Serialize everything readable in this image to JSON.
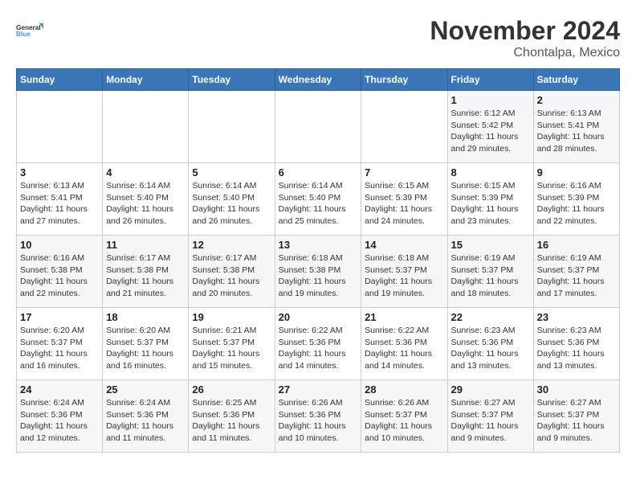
{
  "logo": {
    "line1": "General",
    "line2": "Blue"
  },
  "title": "November 2024",
  "location": "Chontalpa, Mexico",
  "days_of_week": [
    "Sunday",
    "Monday",
    "Tuesday",
    "Wednesday",
    "Thursday",
    "Friday",
    "Saturday"
  ],
  "weeks": [
    [
      {
        "day": "",
        "info": ""
      },
      {
        "day": "",
        "info": ""
      },
      {
        "day": "",
        "info": ""
      },
      {
        "day": "",
        "info": ""
      },
      {
        "day": "",
        "info": ""
      },
      {
        "day": "1",
        "info": "Sunrise: 6:12 AM\nSunset: 5:42 PM\nDaylight: 11 hours and 29 minutes."
      },
      {
        "day": "2",
        "info": "Sunrise: 6:13 AM\nSunset: 5:41 PM\nDaylight: 11 hours and 28 minutes."
      }
    ],
    [
      {
        "day": "3",
        "info": "Sunrise: 6:13 AM\nSunset: 5:41 PM\nDaylight: 11 hours and 27 minutes."
      },
      {
        "day": "4",
        "info": "Sunrise: 6:14 AM\nSunset: 5:40 PM\nDaylight: 11 hours and 26 minutes."
      },
      {
        "day": "5",
        "info": "Sunrise: 6:14 AM\nSunset: 5:40 PM\nDaylight: 11 hours and 26 minutes."
      },
      {
        "day": "6",
        "info": "Sunrise: 6:14 AM\nSunset: 5:40 PM\nDaylight: 11 hours and 25 minutes."
      },
      {
        "day": "7",
        "info": "Sunrise: 6:15 AM\nSunset: 5:39 PM\nDaylight: 11 hours and 24 minutes."
      },
      {
        "day": "8",
        "info": "Sunrise: 6:15 AM\nSunset: 5:39 PM\nDaylight: 11 hours and 23 minutes."
      },
      {
        "day": "9",
        "info": "Sunrise: 6:16 AM\nSunset: 5:39 PM\nDaylight: 11 hours and 22 minutes."
      }
    ],
    [
      {
        "day": "10",
        "info": "Sunrise: 6:16 AM\nSunset: 5:38 PM\nDaylight: 11 hours and 22 minutes."
      },
      {
        "day": "11",
        "info": "Sunrise: 6:17 AM\nSunset: 5:38 PM\nDaylight: 11 hours and 21 minutes."
      },
      {
        "day": "12",
        "info": "Sunrise: 6:17 AM\nSunset: 5:38 PM\nDaylight: 11 hours and 20 minutes."
      },
      {
        "day": "13",
        "info": "Sunrise: 6:18 AM\nSunset: 5:38 PM\nDaylight: 11 hours and 19 minutes."
      },
      {
        "day": "14",
        "info": "Sunrise: 6:18 AM\nSunset: 5:37 PM\nDaylight: 11 hours and 19 minutes."
      },
      {
        "day": "15",
        "info": "Sunrise: 6:19 AM\nSunset: 5:37 PM\nDaylight: 11 hours and 18 minutes."
      },
      {
        "day": "16",
        "info": "Sunrise: 6:19 AM\nSunset: 5:37 PM\nDaylight: 11 hours and 17 minutes."
      }
    ],
    [
      {
        "day": "17",
        "info": "Sunrise: 6:20 AM\nSunset: 5:37 PM\nDaylight: 11 hours and 16 minutes."
      },
      {
        "day": "18",
        "info": "Sunrise: 6:20 AM\nSunset: 5:37 PM\nDaylight: 11 hours and 16 minutes."
      },
      {
        "day": "19",
        "info": "Sunrise: 6:21 AM\nSunset: 5:37 PM\nDaylight: 11 hours and 15 minutes."
      },
      {
        "day": "20",
        "info": "Sunrise: 6:22 AM\nSunset: 5:36 PM\nDaylight: 11 hours and 14 minutes."
      },
      {
        "day": "21",
        "info": "Sunrise: 6:22 AM\nSunset: 5:36 PM\nDaylight: 11 hours and 14 minutes."
      },
      {
        "day": "22",
        "info": "Sunrise: 6:23 AM\nSunset: 5:36 PM\nDaylight: 11 hours and 13 minutes."
      },
      {
        "day": "23",
        "info": "Sunrise: 6:23 AM\nSunset: 5:36 PM\nDaylight: 11 hours and 13 minutes."
      }
    ],
    [
      {
        "day": "24",
        "info": "Sunrise: 6:24 AM\nSunset: 5:36 PM\nDaylight: 11 hours and 12 minutes."
      },
      {
        "day": "25",
        "info": "Sunrise: 6:24 AM\nSunset: 5:36 PM\nDaylight: 11 hours and 11 minutes."
      },
      {
        "day": "26",
        "info": "Sunrise: 6:25 AM\nSunset: 5:36 PM\nDaylight: 11 hours and 11 minutes."
      },
      {
        "day": "27",
        "info": "Sunrise: 6:26 AM\nSunset: 5:36 PM\nDaylight: 11 hours and 10 minutes."
      },
      {
        "day": "28",
        "info": "Sunrise: 6:26 AM\nSunset: 5:37 PM\nDaylight: 11 hours and 10 minutes."
      },
      {
        "day": "29",
        "info": "Sunrise: 6:27 AM\nSunset: 5:37 PM\nDaylight: 11 hours and 9 minutes."
      },
      {
        "day": "30",
        "info": "Sunrise: 6:27 AM\nSunset: 5:37 PM\nDaylight: 11 hours and 9 minutes."
      }
    ]
  ]
}
